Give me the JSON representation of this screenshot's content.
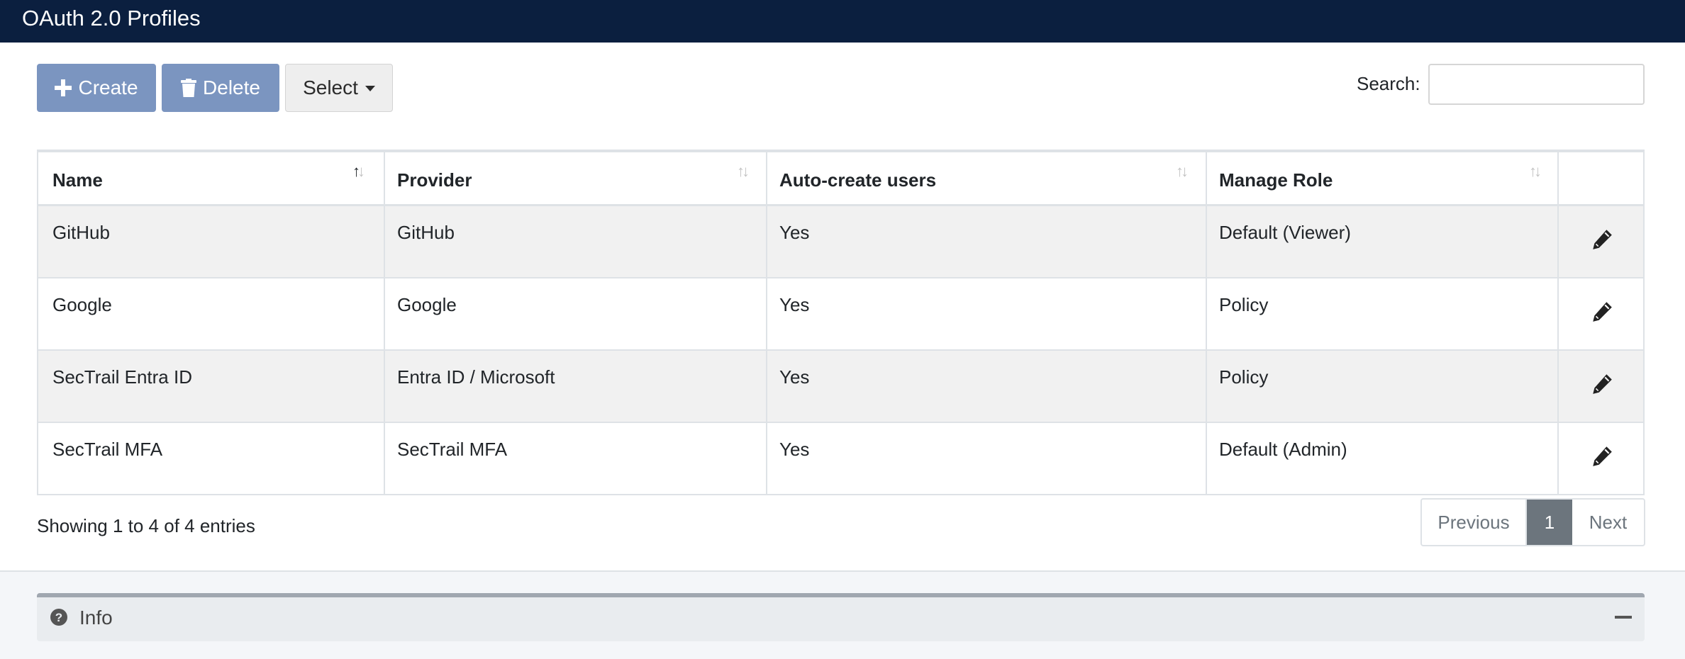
{
  "header": {
    "title": "OAuth 2.0 Profiles"
  },
  "toolbar": {
    "create_label": "Create",
    "delete_label": "Delete",
    "select_label": "Select",
    "search_label": "Search:",
    "search_value": ""
  },
  "table": {
    "columns": [
      "Name",
      "Provider",
      "Auto-create users",
      "Manage Role"
    ],
    "rows": [
      {
        "name": "GitHub",
        "provider": "GitHub",
        "auto_create": "Yes",
        "role": "Default (Viewer)"
      },
      {
        "name": "Google",
        "provider": "Google",
        "auto_create": "Yes",
        "role": "Policy"
      },
      {
        "name": "SecTrail Entra ID",
        "provider": "Entra ID / Microsoft",
        "auto_create": "Yes",
        "role": "Policy"
      },
      {
        "name": "SecTrail MFA",
        "provider": "SecTrail MFA",
        "auto_create": "Yes",
        "role": "Default (Admin)"
      }
    ]
  },
  "footer": {
    "info_text": "Showing 1 to 4 of 4 entries",
    "pagination": {
      "previous": "Previous",
      "current": "1",
      "next": "Next"
    }
  },
  "info_section": {
    "label": "Info"
  },
  "icons": {
    "create": "plus-icon",
    "delete": "trash-icon",
    "select": "caret-down-icon",
    "sort": "sort-arrows-icon",
    "edit": "pencil-icon",
    "info": "question-circle-icon",
    "collapse": "minus-icon"
  },
  "colors": {
    "header_bg": "#0b1f3f",
    "primary_button": "#7b95c0",
    "active_page": "#6c757d",
    "striped_row": "#f1f1f1"
  }
}
